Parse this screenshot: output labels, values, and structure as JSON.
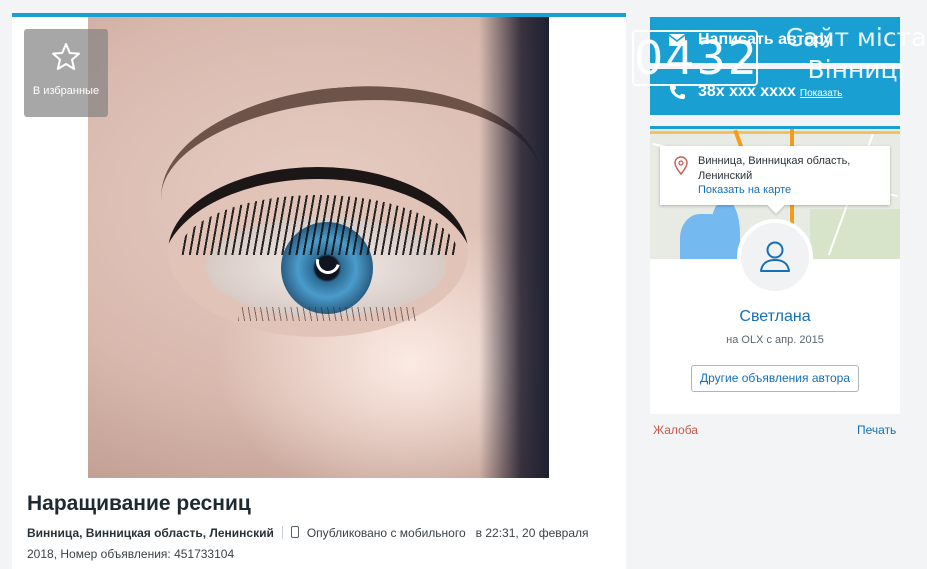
{
  "listing": {
    "favorite_label": "В избранные",
    "title": "Наращивание ресниц",
    "location": "Винница, Винницкая область, Ленинский",
    "published": "Опубликовано с мобильного",
    "published_at": "в 22:31, 20 февраля 2018,",
    "ad_number": "Номер объявления: 451733104"
  },
  "contact": {
    "write_author": "Написать автору",
    "phone": "38x xxx xxxx",
    "show_phone": "Показать"
  },
  "watermark": {
    "logo": "0432",
    "text": "Сайт міста Вінниці"
  },
  "profile": {
    "address": "Винница, Винницкая область, Ленинский",
    "show_on_map": "Показать на карте",
    "user_name": "Светлана",
    "member_since": "на OLX с апр. 2015",
    "other_ads": "Другие объявления автора"
  },
  "footer": {
    "complain": "Жалоба",
    "print": "Печать"
  },
  "colors": {
    "accent": "#1a9fd3",
    "link": "#1470b8",
    "complain": "#c85a4a"
  },
  "icons": [
    "star-icon",
    "mail-icon",
    "phone-icon",
    "map-pin-icon",
    "user-icon",
    "mobile-icon"
  ]
}
